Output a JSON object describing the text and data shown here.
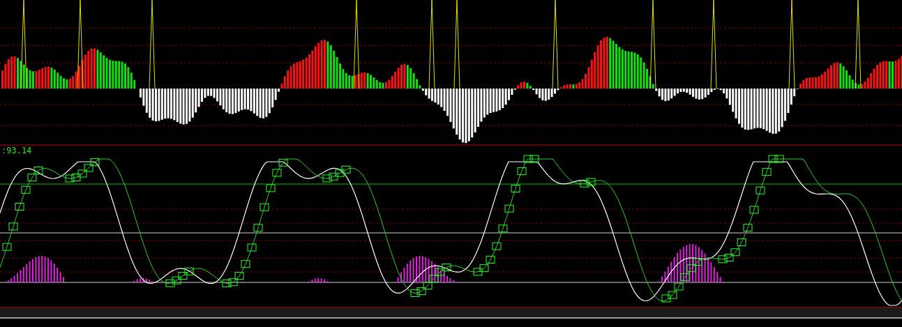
{
  "oscillator_label": ":93.14"
}
